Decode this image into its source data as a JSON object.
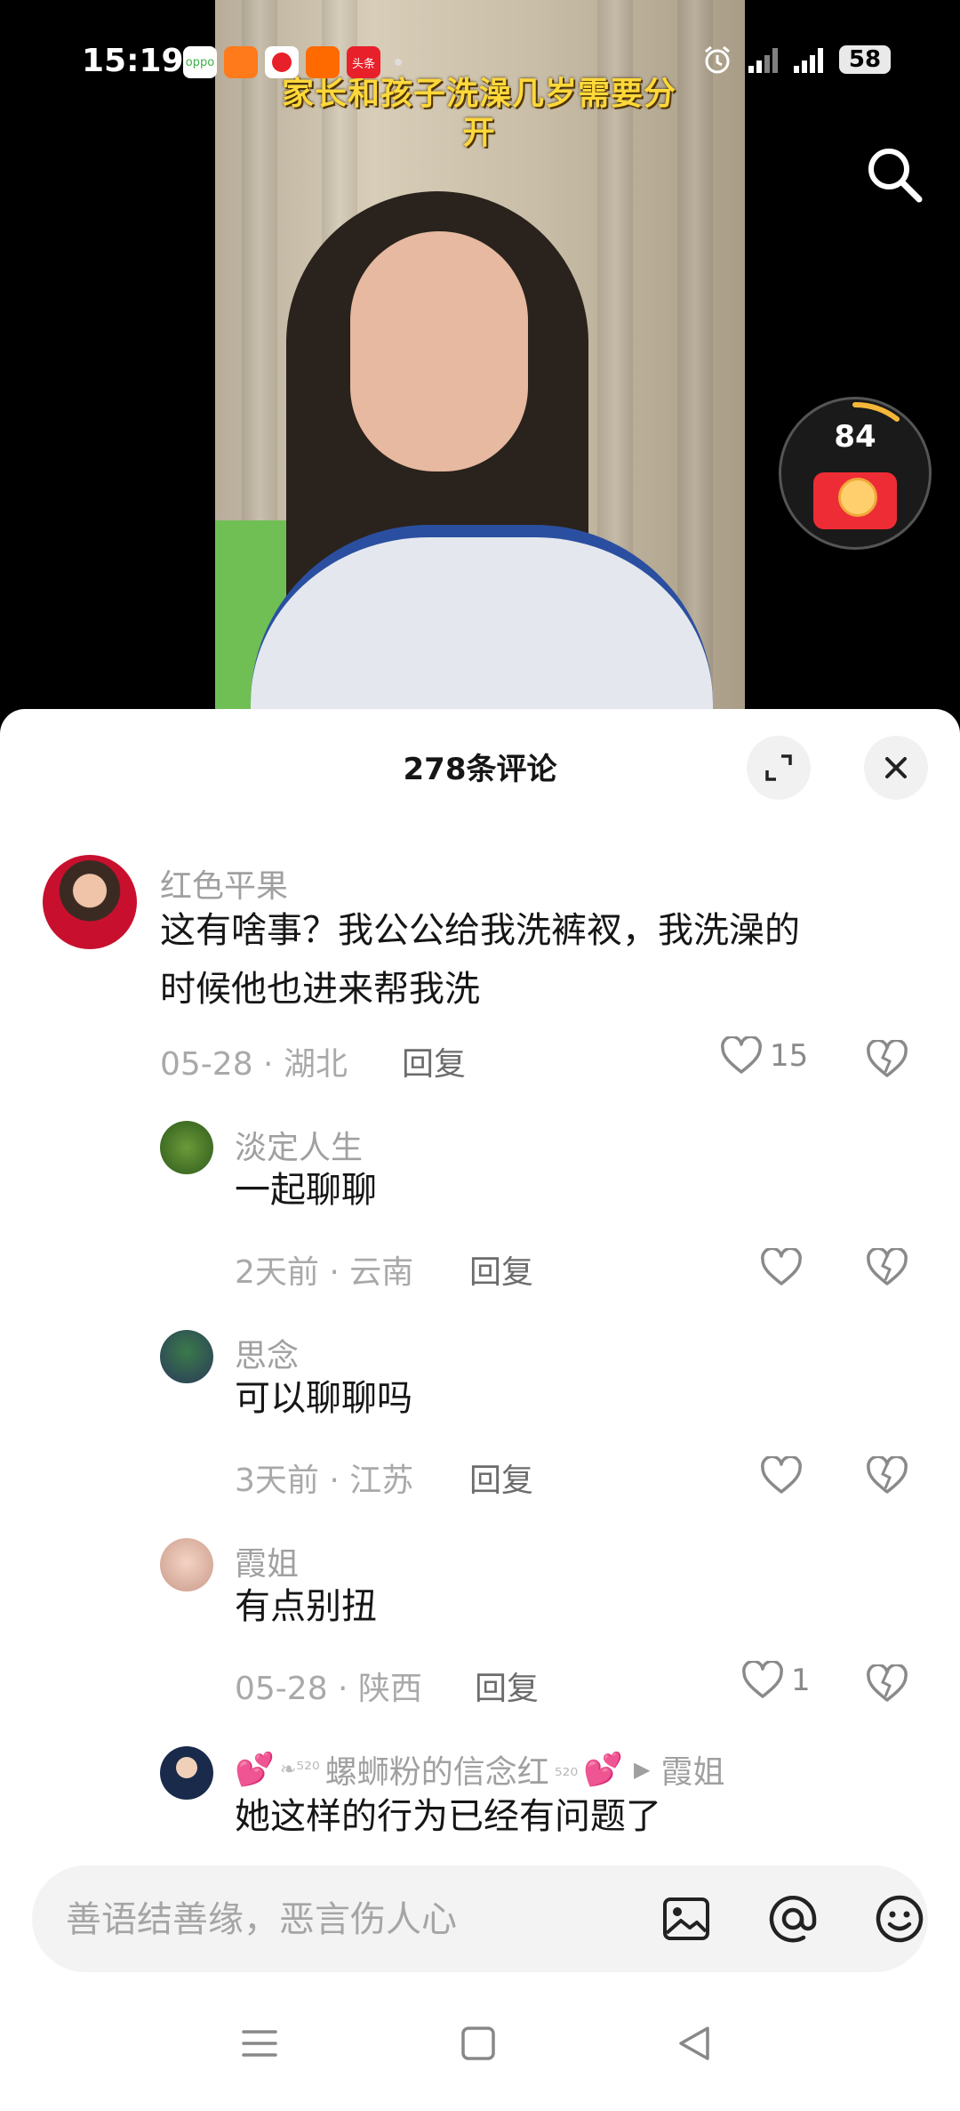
{
  "status": {
    "time": "15:19",
    "battery": "58",
    "apps": [
      {
        "name": "oppo-icon",
        "label": "oppo",
        "color": "#3fb04a"
      },
      {
        "name": "app2-icon",
        "label": "",
        "color": "#ff7a1a"
      },
      {
        "name": "app3-icon",
        "label": "",
        "color": "#e8202a"
      },
      {
        "name": "app4-icon",
        "label": "",
        "color": "#ff6a00"
      },
      {
        "name": "toutiao-icon",
        "label": "头条",
        "color": "#e8202a"
      }
    ]
  },
  "video": {
    "caption": "家长和孩子洗澡几岁需要分开"
  },
  "red_packet": {
    "count": "84",
    "progress": 0.15
  },
  "sheet": {
    "title": "278条评论"
  },
  "comments": [
    {
      "user": "红色平果",
      "text_line1": "这有啥事？我公公给我洗裤衩，我洗澡的",
      "text_line2": "时候他也进来帮我洗",
      "meta": "05-28 · 湖北",
      "reply": "回复",
      "likes": "15"
    },
    {
      "user": "淡定人生",
      "text": "一起聊聊",
      "meta": "2天前 · 云南",
      "reply": "回复",
      "likes": ""
    },
    {
      "user": "思念",
      "text": "可以聊聊吗",
      "meta": "3天前 · 江苏",
      "reply": "回复",
      "likes": ""
    },
    {
      "user": "霞姐",
      "text": "有点别扭",
      "meta": "05-28 · 陕西",
      "reply": "回复",
      "likes": "1"
    },
    {
      "user": "螺蛳粉的信念红",
      "reply_to": "霞姐",
      "text": "她这样的行为已经有问题了"
    }
  ],
  "input": {
    "placeholder": "善语结善缘，恶言伤人心"
  },
  "colors": {
    "caption": "#ffd83a",
    "redpacket": "#ee2c35",
    "sheet_bg": "#ffffff"
  }
}
